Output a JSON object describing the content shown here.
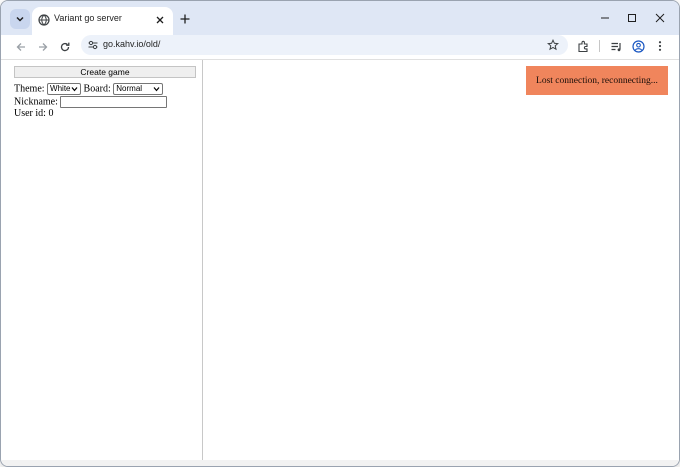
{
  "browser": {
    "tab": {
      "title": "Variant go server",
      "favicon": "globe-icon"
    },
    "address_bar": {
      "url": "go.kahv.io/old/"
    },
    "icons": [
      "tab-search-icon",
      "close-icon",
      "plus-icon",
      "minimize-icon",
      "maximize-icon",
      "back-icon",
      "forward-icon",
      "reload-icon",
      "tune-icon",
      "star-icon",
      "extensions-icon",
      "media-control-icon",
      "profile-icon",
      "more-icon"
    ]
  },
  "sidebar": {
    "create_button": "Create game",
    "theme_label": "Theme:",
    "theme_value": "White",
    "board_label": "Board:",
    "board_value": "Normal",
    "nickname_label": "Nickname:",
    "nickname_value": "",
    "user_id_label": "User id:",
    "user_id_value": "0"
  },
  "notification": {
    "message": "Lost connection, reconnecting...",
    "color": "#f0855c"
  },
  "colors": {
    "tabbar_bg": "#dfe7f5",
    "omnibox_bg": "#edf2fa"
  }
}
